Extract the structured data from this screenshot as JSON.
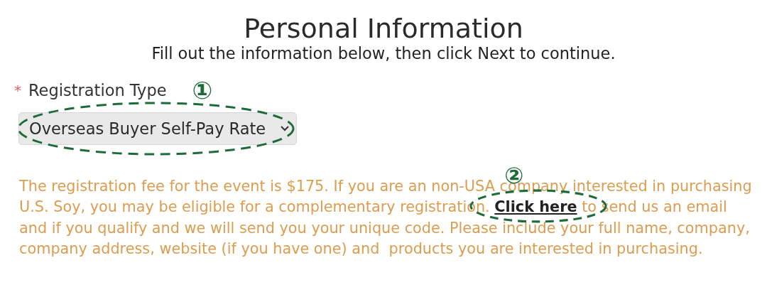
{
  "title": "Personal Information",
  "subtitle": "Fill out the information below, then click Next to continue.",
  "field": {
    "required_mark": "*",
    "label": "Registration Type",
    "value": "Overseas Buyer Self-Pay Rate"
  },
  "notice": {
    "text_before": "The registration fee for the event is $175. If you are an non-USA company interested in purchasing U.S. Soy, you may be eligible for a complementary registration. ",
    "link": "Click here",
    "text_after": " to send us an email and if you qualify and we will send you your unique code. Please include your full name, company, company address, website (if you have one) and  products you are interested in purchasing."
  },
  "annotations": [
    {
      "number": "①"
    },
    {
      "number": "②"
    }
  ]
}
